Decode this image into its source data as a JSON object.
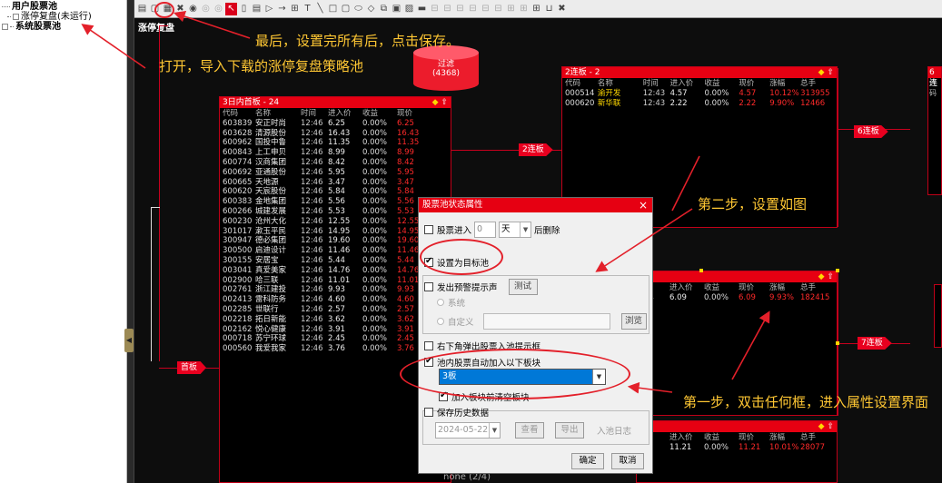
{
  "tree": {
    "items": [
      {
        "label": "用户股票池"
      },
      {
        "label": "涨停复盘(未运行)"
      },
      {
        "label": "系统股票池"
      }
    ]
  },
  "canvas": {
    "title": "涨停复盘"
  },
  "pool_cylinder": {
    "label": "过滤",
    "count": "(4368)"
  },
  "tags": {
    "first_board": "首板",
    "second_board": "2连板",
    "sixth_board": "6连板",
    "seventh_board": "7连板"
  },
  "panel_main": {
    "title": "3日内首板 - 24",
    "headers": [
      "代码",
      "名称",
      "时间",
      "进入价",
      "收益",
      "现价"
    ],
    "rows": [
      [
        "603839",
        "安正时尚",
        "12:46",
        "6.25",
        "0.00%",
        "6.25"
      ],
      [
        "603628",
        "清源股份",
        "12:46",
        "16.43",
        "0.00%",
        "16.43"
      ],
      [
        "600962",
        "国投中鲁",
        "12:46",
        "11.35",
        "0.00%",
        "11.35"
      ],
      [
        "600843",
        "上工申贝",
        "12:46",
        "8.99",
        "0.00%",
        "8.99"
      ],
      [
        "600774",
        "汉商集团",
        "12:46",
        "8.42",
        "0.00%",
        "8.42"
      ],
      [
        "600692",
        "亚通股份",
        "12:46",
        "5.95",
        "0.00%",
        "5.95"
      ],
      [
        "600665",
        "天地源",
        "12:46",
        "3.47",
        "0.00%",
        "3.47"
      ],
      [
        "600620",
        "天宸股份",
        "12:46",
        "5.84",
        "0.00%",
        "5.84"
      ],
      [
        "600383",
        "金地集团",
        "12:46",
        "5.56",
        "0.00%",
        "5.56"
      ],
      [
        "600266",
        "城建发展",
        "12:46",
        "5.53",
        "0.00%",
        "5.53"
      ],
      [
        "600230",
        "沧州大化",
        "12:46",
        "12.55",
        "0.00%",
        "12.55"
      ],
      [
        "301017",
        "漱玉平民",
        "12:46",
        "14.95",
        "0.00%",
        "14.95"
      ],
      [
        "300947",
        "德必集团",
        "12:46",
        "19.60",
        "0.00%",
        "19.60"
      ],
      [
        "300500",
        "启迪设计",
        "12:46",
        "11.46",
        "0.00%",
        "11.46"
      ],
      [
        "300155",
        "安居宝",
        "12:46",
        "5.44",
        "0.00%",
        "5.44"
      ],
      [
        "003041",
        "真爱美家",
        "12:46",
        "14.76",
        "0.00%",
        "14.76"
      ],
      [
        "002900",
        "哈三联",
        "12:46",
        "11.01",
        "0.00%",
        "11.01"
      ],
      [
        "002761",
        "浙江建投",
        "12:46",
        "9.93",
        "0.00%",
        "9.93"
      ],
      [
        "002413",
        "雷科防务",
        "12:46",
        "4.60",
        "0.00%",
        "4.60"
      ],
      [
        "002285",
        "世联行",
        "12:46",
        "2.57",
        "0.00%",
        "2.57"
      ],
      [
        "002218",
        "拓日新能",
        "12:46",
        "3.62",
        "0.00%",
        "3.62"
      ],
      [
        "002162",
        "悦心健康",
        "12:46",
        "3.91",
        "0.00%",
        "3.91"
      ],
      [
        "000718",
        "苏宁环球",
        "12:46",
        "2.45",
        "0.00%",
        "2.45"
      ],
      [
        "000560",
        "我爱我家",
        "12:46",
        "3.76",
        "0.00%",
        "3.76"
      ]
    ]
  },
  "panel_two": {
    "title": "2连板 - 2",
    "headers": [
      "代码",
      "名称",
      "时间",
      "进入价",
      "收益",
      "现价",
      "涨幅",
      "总手"
    ],
    "rows": [
      [
        "000514",
        "渝开发",
        "12:43",
        "4.57",
        "0.00%",
        "4.57",
        "10.12%",
        "313955"
      ],
      [
        "000620",
        "新华联",
        "12:43",
        "2.22",
        "0.00%",
        "2.22",
        "9.90%",
        "12466"
      ]
    ]
  },
  "panel_mid": {
    "headers": [
      "间",
      "进入价",
      "收益",
      "现价",
      "涨幅",
      "总手"
    ],
    "rows": [
      [
        "44",
        "6.09",
        "0.00%",
        "6.09",
        "9.93%",
        "182415"
      ]
    ]
  },
  "panel_bottom": {
    "headers": [
      "间",
      "进入价",
      "收益",
      "现价",
      "涨幅",
      "总手"
    ],
    "rows": [
      [
        "45",
        "11.21",
        "0.00%",
        "11.21",
        "10.01%",
        "28077"
      ]
    ]
  },
  "panel_far_right": {
    "title": "6连",
    "header": "代码"
  },
  "footer_text": "none (2/4)",
  "annotations": {
    "final": "最后，设置完所有后，点击保存。",
    "open": "打开，导入下载的涨停复盘策略池",
    "step2": "第二步，设置如图",
    "step1": "第一步，双击任何框，进入属性设置界面"
  },
  "dialog": {
    "title": "股票池状态属性",
    "close": "×",
    "stock_in_label": "股票进入",
    "days_value": "0",
    "days_unit": "天",
    "delete_after": "后删除",
    "set_target": "设置为目标池",
    "alert_sound": "发出预警提示声",
    "test_button": "测试",
    "sound_system": "系统",
    "sound_custom": "自定义",
    "browse_button": "浏览",
    "popup_tip": "右下角弹出股票入池提示框",
    "auto_add": "池内股票自动加入以下板块",
    "block_value": "3板",
    "clear_block": "加入板块前清空板块",
    "save_history": "保存历史数据",
    "date_value": "2024-05-22",
    "view_button": "查看",
    "export_button": "导出",
    "in_pool_log": "入池日志",
    "ok_button": "确定",
    "cancel_button": "取消"
  },
  "colors": {
    "accent_red": "#e60012",
    "annotation_yellow": "#ffc733",
    "selection_blue": "#0078d7"
  }
}
